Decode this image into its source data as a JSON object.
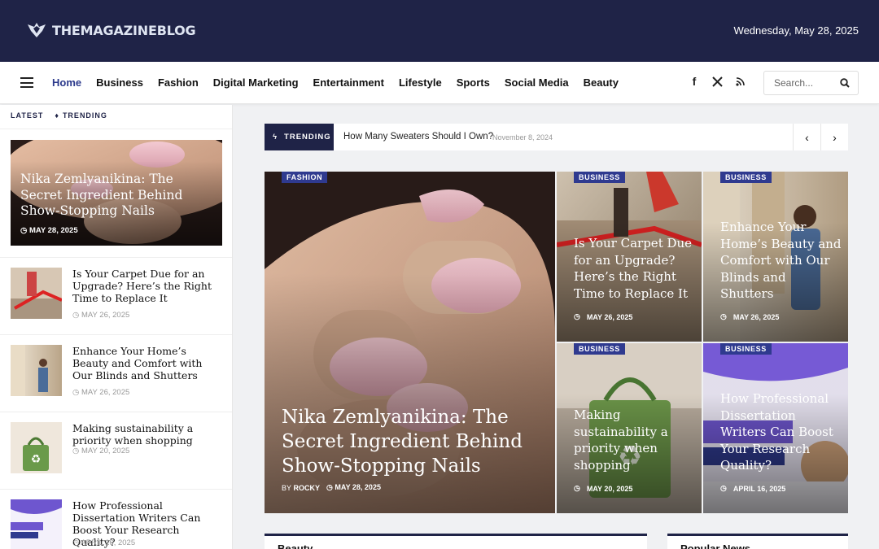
{
  "brand": {
    "name": "THEMAGAZINEBLOG",
    "date": "Wednesday, May 28, 2025",
    "colors": {
      "primary": "#1f2347",
      "accent": "#2f3a8f"
    }
  },
  "nav": {
    "items": [
      "Home",
      "Business",
      "Fashion",
      "Digital Marketing",
      "Entertainment",
      "Lifestyle",
      "Sports",
      "Social Media",
      "Beauty"
    ],
    "active": "Home",
    "social_icons": [
      "facebook-icon",
      "x-icon",
      "rss-icon"
    ],
    "search_placeholder": "Search..."
  },
  "sidebar": {
    "tabs": [
      "LATEST",
      "TRENDING"
    ],
    "featured": {
      "title": "Nika Zemlyanikina: The Secret Ingredient Behind Show-Stopping Nails",
      "date": "MAY 28, 2025"
    },
    "items": [
      {
        "title": "Is Your Carpet Due for an Upgrade? Here’s the Right Time to Replace It",
        "date": "MAY 26, 2025"
      },
      {
        "title": "Enhance Your Home’s Beauty and Comfort with Our Blinds and Shutters",
        "date": "MAY 26, 2025"
      },
      {
        "title": "Making sustainability a priority when shopping",
        "date": "MAY 20, 2025"
      },
      {
        "title": "How Professional Dissertation Writers Can Boost Your Research Quality?",
        "date": "APRIL 16, 2025"
      }
    ]
  },
  "trending": {
    "label": "TRENDING",
    "title": "How Many Sweaters Should I Own?",
    "date": "November 8, 2024"
  },
  "featured": {
    "main": {
      "category": "FASHION",
      "title": "Nika Zemlyanikina: The Secret Ingredient Behind Show-Stopping Nails",
      "by": "BY",
      "author": "ROCKY",
      "date": "MAY 28, 2025"
    },
    "grid": [
      {
        "category": "BUSINESS",
        "title": "Is Your Carpet Due for an Upgrade? Here’s the Right Time to Replace It",
        "date": "MAY 26, 2025"
      },
      {
        "category": "BUSINESS",
        "title": "Enhance Your Home’s Beauty and Comfort with Our Blinds and Shutters",
        "date": "MAY 26, 2025"
      },
      {
        "category": "BUSINESS",
        "title": "Making sustainability a priority when shopping",
        "date": "MAY 20, 2025"
      },
      {
        "category": "BUSINESS",
        "title": "How Professional Dissertation Writers Can Boost Your Research Quality?",
        "date": "APRIL 16, 2025"
      }
    ]
  },
  "sections": {
    "beauty": "Beauty",
    "popular": "Popular News"
  }
}
